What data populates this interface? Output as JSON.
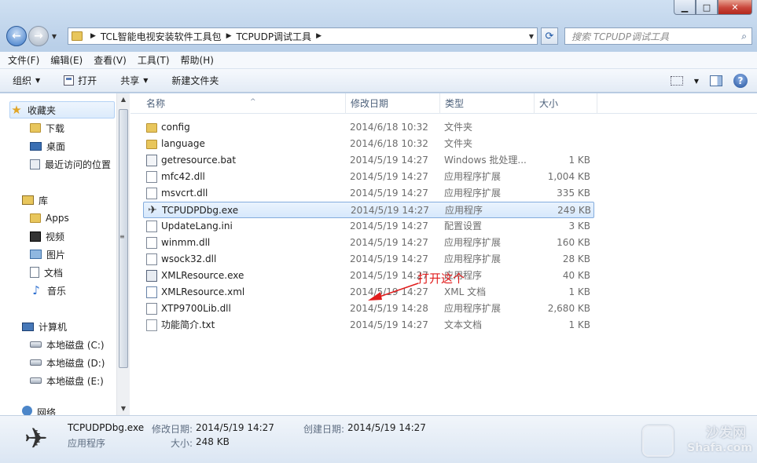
{
  "window": {
    "min_icon": "minimize-icon",
    "max_icon": "maximize-icon",
    "close_icon": "close-icon"
  },
  "address": {
    "crumbs": [
      "TCL智能电视安装软件工具包",
      "TCPUDP调试工具"
    ]
  },
  "search": {
    "placeholder": "搜索 TCPUDP调试工具"
  },
  "menu": [
    "文件(F)",
    "编辑(E)",
    "查看(V)",
    "工具(T)",
    "帮助(H)"
  ],
  "toolbar": {
    "organize": "组织",
    "open": "打开",
    "share": "共享",
    "new_folder": "新建文件夹"
  },
  "nav": {
    "favorites": "收藏夹",
    "downloads": "下载",
    "desktop": "桌面",
    "recent": "最近访问的位置",
    "libraries": "库",
    "apps": "Apps",
    "videos": "视频",
    "pictures": "图片",
    "documents": "文档",
    "music": "音乐",
    "computer": "计算机",
    "drive_c": "本地磁盘 (C:)",
    "drive_d": "本地磁盘 (D:)",
    "drive_e": "本地磁盘 (E:)",
    "network": "网络"
  },
  "columns": {
    "name": "名称",
    "date": "修改日期",
    "type": "类型",
    "size": "大小"
  },
  "files": [
    {
      "name": "config",
      "date": "2014/6/18 10:32",
      "type": "文件夹",
      "size": "",
      "icon": "folder"
    },
    {
      "name": "language",
      "date": "2014/6/18 10:32",
      "type": "文件夹",
      "size": "",
      "icon": "folder"
    },
    {
      "name": "getresource.bat",
      "date": "2014/5/19 14:27",
      "type": "Windows 批处理...",
      "size": "1 KB",
      "icon": "bat"
    },
    {
      "name": "mfc42.dll",
      "date": "2014/5/19 14:27",
      "type": "应用程序扩展",
      "size": "1,004 KB",
      "icon": "dll"
    },
    {
      "name": "msvcrt.dll",
      "date": "2014/5/19 14:27",
      "type": "应用程序扩展",
      "size": "335 KB",
      "icon": "dll"
    },
    {
      "name": "TCPUDPDbg.exe",
      "date": "2014/5/19 14:27",
      "type": "应用程序",
      "size": "249 KB",
      "icon": "plane"
    },
    {
      "name": "UpdateLang.ini",
      "date": "2014/5/19 14:27",
      "type": "配置设置",
      "size": "3 KB",
      "icon": "ini"
    },
    {
      "name": "winmm.dll",
      "date": "2014/5/19 14:27",
      "type": "应用程序扩展",
      "size": "160 KB",
      "icon": "dll"
    },
    {
      "name": "wsock32.dll",
      "date": "2014/5/19 14:27",
      "type": "应用程序扩展",
      "size": "28 KB",
      "icon": "dll"
    },
    {
      "name": "XMLResource.exe",
      "date": "2014/5/19 14:27",
      "type": "应用程序",
      "size": "40 KB",
      "icon": "exe"
    },
    {
      "name": "XMLResource.xml",
      "date": "2014/5/19 14:27",
      "type": "XML 文档",
      "size": "1 KB",
      "icon": "xml"
    },
    {
      "name": "XTP9700Lib.dll",
      "date": "2014/5/19 14:28",
      "type": "应用程序扩展",
      "size": "2,680 KB",
      "icon": "dll"
    },
    {
      "name": "功能简介.txt",
      "date": "2014/5/19 14:27",
      "type": "文本文档",
      "size": "1 KB",
      "icon": "txt"
    }
  ],
  "annotation": "打开这个",
  "details": {
    "name": "TCPUDPDbg.exe",
    "kind": "应用程序",
    "modified_label": "修改日期:",
    "modified": "2014/5/19 14:27",
    "created_label": "创建日期:",
    "created": "2014/5/19 14:27",
    "size_label": "大小:",
    "size": "248 KB"
  },
  "watermark": {
    "text": "沙发网",
    "url": "Shafa.com"
  },
  "colors": {
    "selection": "#d6e8fc",
    "annotation": "#e11c1c",
    "titlebar": "#b9cfe8"
  }
}
